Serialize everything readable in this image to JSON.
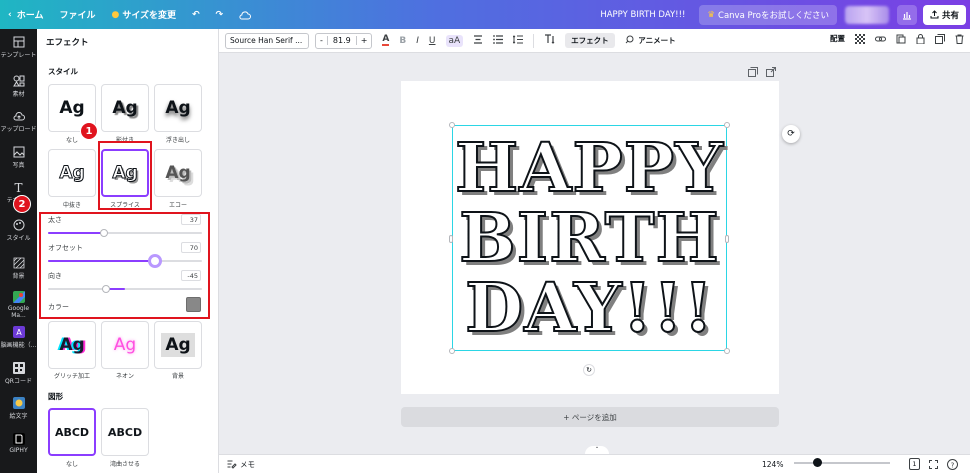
{
  "topbar": {
    "home": "ホーム",
    "file": "ファイル",
    "resize": "サイズを変更",
    "doc_title": "HAPPY BIRTH DAY!!!",
    "pro": "Canva Proをお試しください",
    "share": "共有"
  },
  "rail": [
    {
      "label": "テンプレート",
      "icon": "template-icon"
    },
    {
      "label": "素材",
      "icon": "elements-icon"
    },
    {
      "label": "アップロード",
      "icon": "upload-icon"
    },
    {
      "label": "写真",
      "icon": "photo-icon"
    },
    {
      "label": "テキスト",
      "icon": "text-icon"
    },
    {
      "label": "スタイル",
      "icon": "style-icon"
    },
    {
      "label": "背景",
      "icon": "background-icon"
    },
    {
      "label": "Google Ma...",
      "icon": "google-maps-icon"
    },
    {
      "label": "脳画機能（...",
      "icon": "app-icon"
    },
    {
      "label": "QRコード",
      "icon": "qr-code-icon"
    },
    {
      "label": "絵文字",
      "icon": "emoji-icon"
    },
    {
      "label": "GIPHY",
      "icon": "giphy-icon"
    }
  ],
  "panel": {
    "title": "エフェクト",
    "style_section": "スタイル",
    "shape_section": "図形",
    "effects": [
      {
        "label": "なし",
        "sample": "Ag"
      },
      {
        "label": "影付き",
        "sample": "Ag"
      },
      {
        "label": "浮き出し",
        "sample": "Ag"
      },
      {
        "label": "中抜き",
        "sample": "Ag"
      },
      {
        "label": "スプライス",
        "sample": "Ag"
      },
      {
        "label": "エコー",
        "sample": "Ag"
      },
      {
        "label": "グリッチ加工",
        "sample": "Ag"
      },
      {
        "label": "ネオン",
        "sample": "Ag"
      },
      {
        "label": "背景",
        "sample": "Ag"
      }
    ],
    "shapes": [
      {
        "label": "なし",
        "sample": "ABCD"
      },
      {
        "label": "湾曲させる",
        "sample": "ABCD"
      }
    ],
    "sliders": [
      {
        "label": "太さ",
        "value": "37",
        "fraction": 0.37
      },
      {
        "label": "オフセット",
        "value": "70",
        "fraction": 0.7
      },
      {
        "label": "向き",
        "value": "-45",
        "fraction": 0.375
      }
    ],
    "color_label": "カラー",
    "color_value": "#888888",
    "badges": [
      "1",
      "2"
    ]
  },
  "toolbar": {
    "font": "Source Han Serif ...",
    "size_minus": "-",
    "size": "81.9",
    "size_plus": "+",
    "bold": "B",
    "italic": "I",
    "underline": "U",
    "case": "aA",
    "effect": "エフェクト",
    "animate": "アニメート",
    "position": "配置"
  },
  "canvas": {
    "lines": [
      "HAPPY",
      "BIRTH",
      "DAY!!!"
    ],
    "add_page": "+ ページを追加"
  },
  "bottombar": {
    "notes": "メモ",
    "zoom": "124%",
    "page_count": "1"
  },
  "colors": {
    "accent": "#8b3dff",
    "annotation_red": "#e0141e",
    "selection_cyan": "#2bd6e5"
  }
}
